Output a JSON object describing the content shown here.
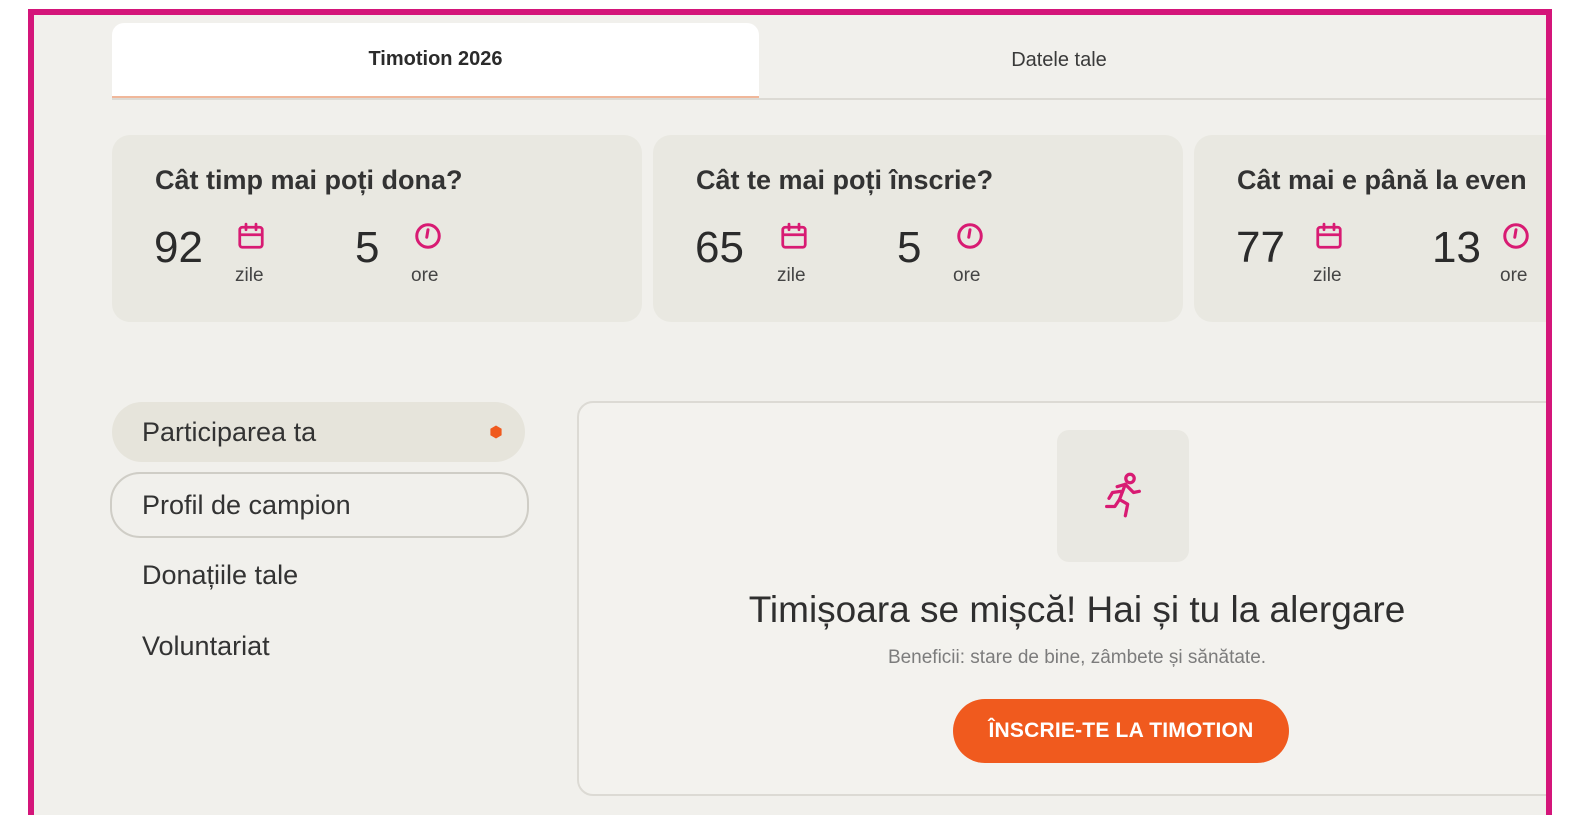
{
  "tabs": [
    {
      "label": "Timotion 2026",
      "active": true
    },
    {
      "label": "Datele tale",
      "active": false
    }
  ],
  "countdowns": [
    {
      "title": "Cât timp mai poți dona?",
      "days": "92",
      "days_unit": "zile",
      "hours": "5",
      "hours_unit": "ore"
    },
    {
      "title": "Cât te mai poți înscrie?",
      "days": "65",
      "days_unit": "zile",
      "hours": "5",
      "hours_unit": "ore"
    },
    {
      "title": "Cât mai e până la even",
      "days": "77",
      "days_unit": "zile",
      "hours": "13",
      "hours_unit": "ore"
    }
  ],
  "menu": [
    {
      "label": "Participarea ta",
      "active": true
    },
    {
      "label": "Profil de campion"
    },
    {
      "label": "Donațiile tale"
    },
    {
      "label": "Voluntariat"
    }
  ],
  "panel": {
    "icon": "runner-icon",
    "title": "Timișoara se mișcă! Hai și tu la alergare",
    "subtitle": "Beneficii: stare de bine, zâmbete și sănătate.",
    "cta_label": "ÎNSCRIE-TE LA TIMOTION"
  },
  "colors": {
    "frame": "#d4157a",
    "accent_icon": "#d81b73",
    "cta": "#f05a1e",
    "background": "#f1f0ec"
  }
}
